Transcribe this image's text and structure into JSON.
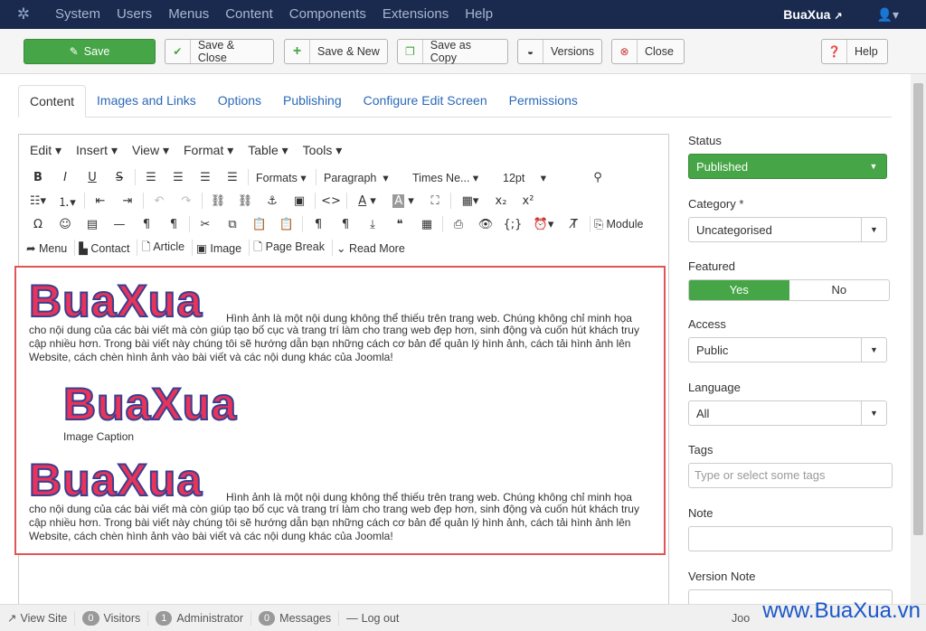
{
  "navbar": {
    "logo": "✲",
    "items": [
      "System",
      "Users",
      "Menus",
      "Content",
      "Components",
      "Extensions",
      "Help"
    ],
    "brand": "BuaXua",
    "brand_icon": "external-link-icon",
    "user_icon": "👤▾"
  },
  "toolbar": {
    "save": "Save",
    "save_close": "Save & Close",
    "save_new": "Save & New",
    "save_copy": "Save as Copy",
    "versions": "Versions",
    "close": "Close",
    "help": "Help"
  },
  "tabs": [
    "Content",
    "Images and Links",
    "Options",
    "Publishing",
    "Configure Edit Screen",
    "Permissions"
  ],
  "editor": {
    "menu": [
      "Edit ▾",
      "Insert ▾",
      "View ▾",
      "Format ▾",
      "Table ▾",
      "Tools ▾"
    ],
    "formats": "Formats",
    "paragraph": "Paragraph",
    "font": "Times Ne...",
    "size": "12pt",
    "module": "Module",
    "xtd": [
      "Menu",
      "Contact",
      "Article",
      "Image",
      "Page Break",
      "Read More"
    ]
  },
  "content": {
    "logo_text": "BuaXua",
    "paragraph_first": "Hình ảnh là một nội dung không thể thiếu trên trang web. Chúng không chỉ minh họa",
    "paragraph_rest": "cho nội dung của các bài viết mà còn giúp tạo bố cục và trang trí làm cho trang web đẹp hơn, sinh động và cuốn hút khách truy cập nhiều hơn. Trong bài viết này chúng tôi sẽ hướng dẫn bạn những cách cơ bản để quản lý hình ảnh, cách tải hình ảnh lên Website, cách chèn hình ảnh vào bài viết và các nội dung khác của Joomla!",
    "caption": "Image Caption"
  },
  "side": {
    "status_label": "Status",
    "status_value": "Published",
    "category_label": "Category *",
    "category_value": "Uncategorised",
    "featured_label": "Featured",
    "featured_yes": "Yes",
    "featured_no": "No",
    "access_label": "Access",
    "access_value": "Public",
    "language_label": "Language",
    "language_value": "All",
    "tags_label": "Tags",
    "tags_placeholder": "Type or select some tags",
    "note_label": "Note",
    "version_note_label": "Version Note"
  },
  "footer": {
    "view_site": "View Site",
    "visitors_count": "0",
    "visitors": "Visitors",
    "admin_count": "1",
    "admin": "Administrator",
    "messages_count": "0",
    "messages": "Messages",
    "logout": "Log out",
    "joo": "Joo"
  },
  "watermark": "www.BuaXua.vn",
  "colors": {
    "navbar": "#1a2a4f",
    "accent_green": "#46a546",
    "link": "#2a69b8",
    "highlight_border": "#e05555"
  }
}
